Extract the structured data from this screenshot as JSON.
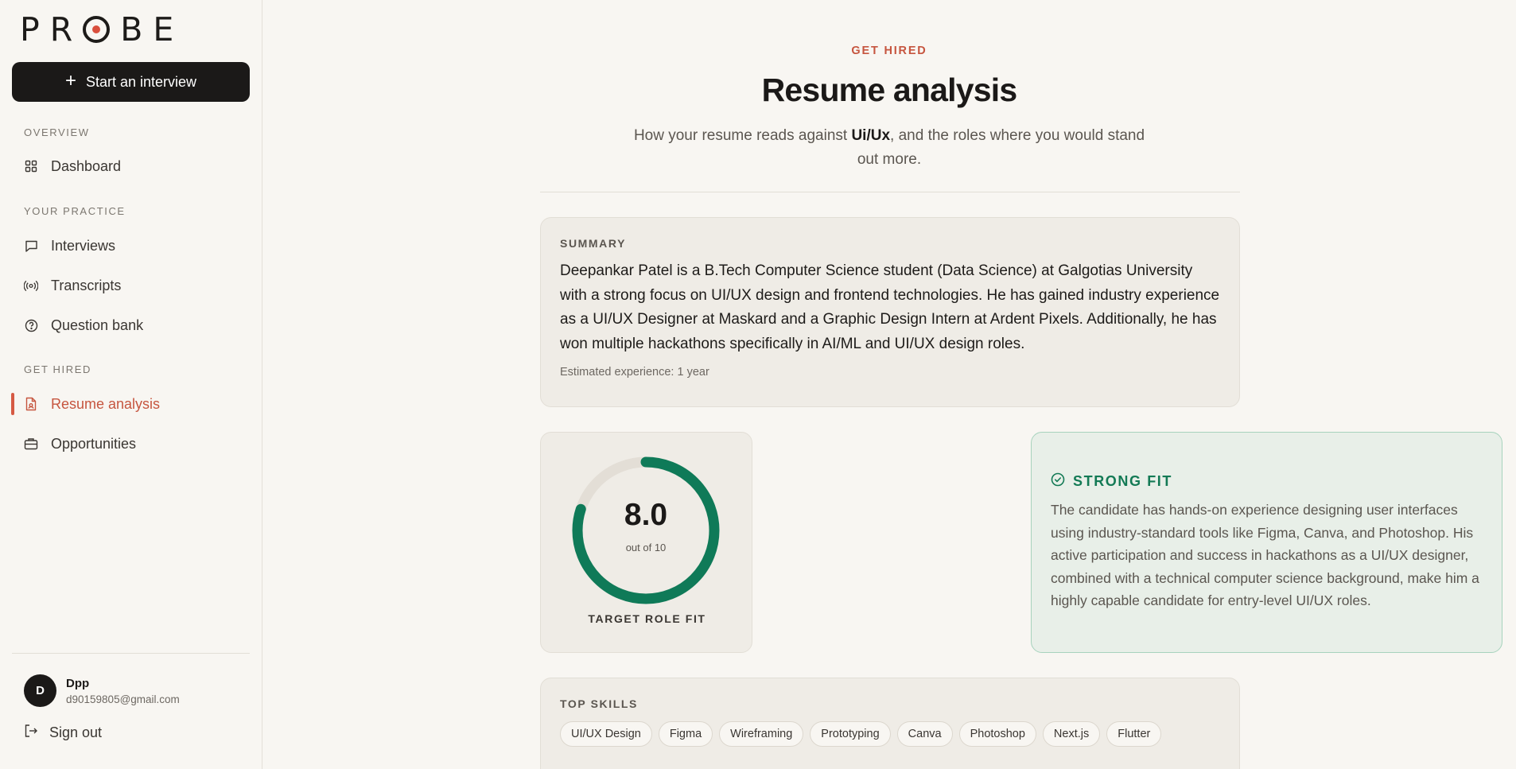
{
  "brand": {
    "logo_text": "PROBE",
    "accent_color": "#d94f3d"
  },
  "sidebar": {
    "start_button": "Start an interview",
    "sections": [
      {
        "title": "OVERVIEW",
        "items": [
          {
            "label": "Dashboard",
            "icon": "grid-icon"
          }
        ]
      },
      {
        "title": "YOUR PRACTICE",
        "items": [
          {
            "label": "Interviews",
            "icon": "chat-bubble-icon"
          },
          {
            "label": "Transcripts",
            "icon": "broadcast-icon"
          },
          {
            "label": "Question bank",
            "icon": "question-circle-icon"
          }
        ]
      },
      {
        "title": "GET HIRED",
        "items": [
          {
            "label": "Resume analysis",
            "icon": "document-icon",
            "active": true
          },
          {
            "label": "Opportunities",
            "icon": "briefcase-icon"
          }
        ]
      }
    ],
    "user": {
      "initial": "D",
      "name": "Dpp",
      "email": "d90159805@gmail.com"
    },
    "sign_out": "Sign out"
  },
  "main": {
    "eyebrow": "GET HIRED",
    "title": "Resume analysis",
    "subtitle_pre": "How your resume reads against ",
    "subtitle_role": "Ui/Ux",
    "subtitle_post": ", and the roles where you would stand out more.",
    "summary": {
      "label": "SUMMARY",
      "text": "Deepankar Patel is a B.Tech Computer Science student (Data Science) at Galgotias University with a strong focus on UI/UX design and frontend technologies. He has gained industry experience as a UI/UX Designer at Maskard and a Graphic Design Intern at Ardent Pixels. Additionally, he has won multiple hackathons specifically in AI/ML and UI/UX design roles.",
      "experience": "Estimated experience: 1 year"
    },
    "score": {
      "value": "8.0",
      "max_label": "out of 10",
      "fraction": 0.8,
      "label": "TARGET ROLE FIT",
      "color": "#0f7a58"
    },
    "fit": {
      "title": "STRONG FIT",
      "color": "#137a55",
      "text": "The candidate has hands-on experience designing user interfaces using industry-standard tools like Figma, Canva, and Photoshop. His active participation and success in hackathons as a UI/UX designer, combined with a technical computer science background, make him a highly capable candidate for entry-level UI/UX roles."
    },
    "skills": {
      "label": "TOP SKILLS",
      "items": [
        "UI/UX Design",
        "Figma",
        "Wireframing",
        "Prototyping",
        "Canva",
        "Photoshop",
        "Next.js",
        "Flutter"
      ]
    }
  }
}
